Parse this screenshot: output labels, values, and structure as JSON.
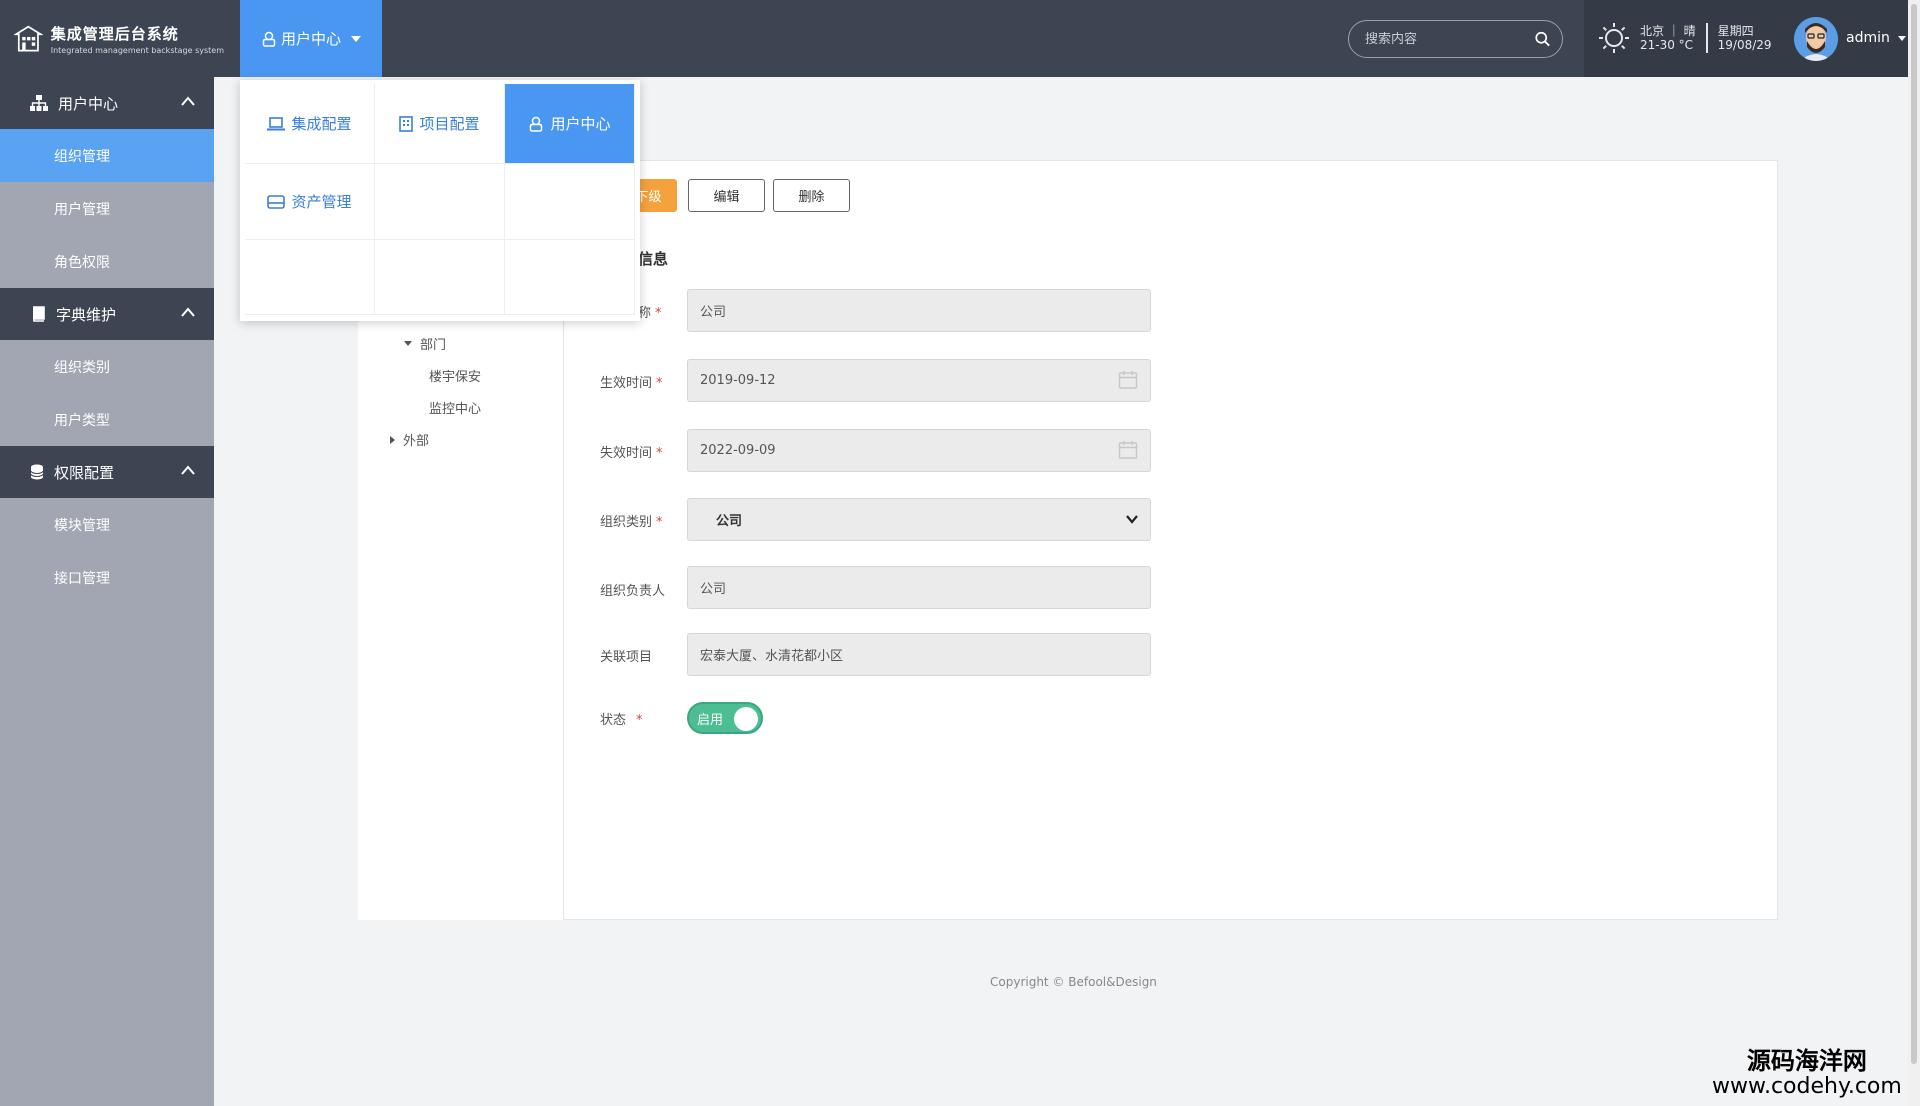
{
  "brand": {
    "title": "集成管理后台系统",
    "subtitle": "Integrated management backstage system"
  },
  "top_menu": {
    "label": "用户中心"
  },
  "search": {
    "placeholder": "搜索内容"
  },
  "weather": {
    "city_line": "北京 ｜ 晴",
    "temp": "21-30 °C",
    "weekday": "星期四",
    "date": "19/08/29"
  },
  "user": {
    "name": "admin"
  },
  "sidebar": {
    "groups": [
      {
        "label": "用户中心",
        "items": [
          "组织管理",
          "用户管理",
          "角色权限"
        ]
      },
      {
        "label": "字典维护",
        "items": [
          "组织类别",
          "用户类型"
        ]
      },
      {
        "label": "权限配置",
        "items": [
          "模块管理",
          "接口管理"
        ]
      }
    ]
  },
  "dropdown": {
    "items": [
      "集成配置",
      "项目配置",
      "用户中心",
      "资产管理"
    ]
  },
  "toolbar": {
    "add_child": "下级",
    "edit": "编辑",
    "delete": "删除"
  },
  "tree": {
    "dept": "部门",
    "child1": "楼宇保安",
    "child2": "监控中心",
    "external": "外部"
  },
  "form": {
    "section": "信息",
    "name_label": "称",
    "name_value": "公司",
    "start_label": "生效时间",
    "start_value": "2019-09-12",
    "end_label": "失效时间",
    "end_value": "2022-09-09",
    "category_label": "组织类别",
    "category_value": "公司",
    "leader_label": "组织负责人",
    "leader_value": "公司",
    "project_label": "关联项目",
    "project_value": "宏泰大厦、水清花都小区",
    "status_label": "状态",
    "status_value": "启用"
  },
  "footer": {
    "copyright": "Copyright © Befool&Design"
  },
  "watermark": {
    "line1": "源码海洋网",
    "line2": "www.codehy.com"
  },
  "colors": {
    "header": "#3d4452",
    "accent": "#4a97f2",
    "sidebar": "#a2a6b3",
    "toggle_on": "#4dbd94",
    "orange": "#f4a23c"
  }
}
